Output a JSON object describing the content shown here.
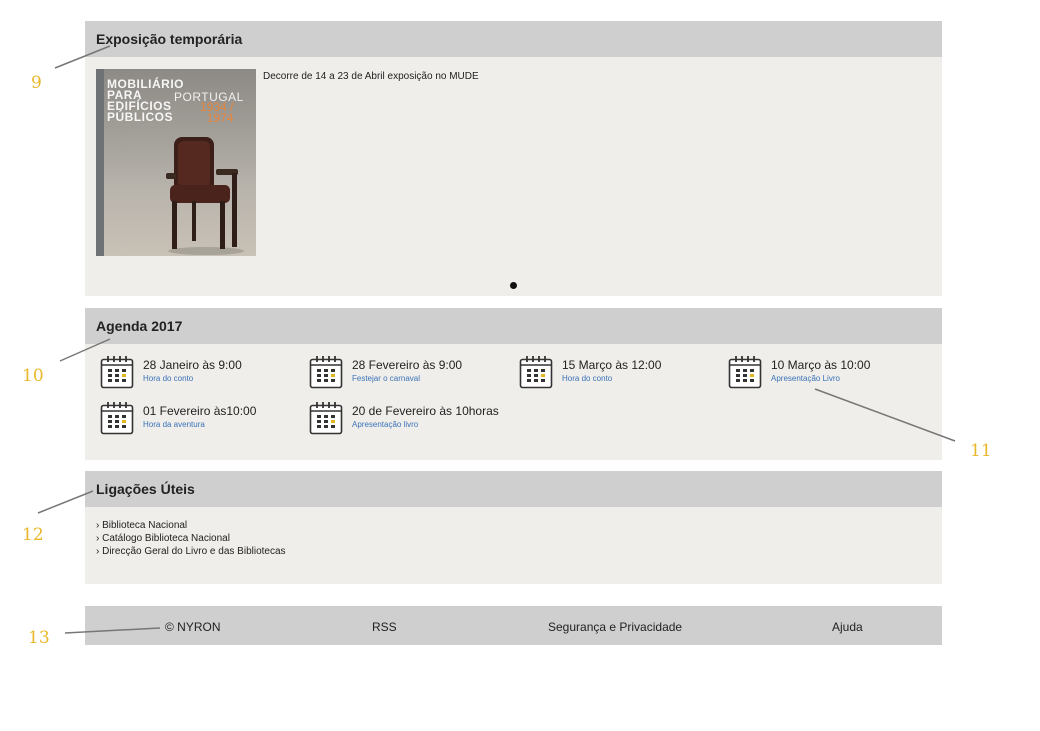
{
  "exhibit": {
    "title": "Exposição temporária",
    "description": "Decorre de 14 a 23 de Abril exposição no MUDE",
    "poster": {
      "title": "MOBILIÁRIO\nPARA\nEDIFÍCIOS\nPÚBLICOS",
      "country": "PORTUGAL",
      "years": "1934 /\n1974"
    }
  },
  "agenda": {
    "title": "Agenda 2017",
    "events": [
      {
        "date": "28 Janeiro às 9:00",
        "link": "Hora do conto"
      },
      {
        "date": "28 Fevereiro às 9:00",
        "link": "Festejar o carnaval"
      },
      {
        "date": "15 Março  às 12:00",
        "link": "Hora do conto"
      },
      {
        "date": "10 Março às 10:00",
        "link": "Apresentação Livro"
      },
      {
        "date": "01 Fevereiro às10:00",
        "link": "Hora da aventura"
      },
      {
        "date": "20 de Fevereiro às 10horas",
        "link": "Apresentação livro"
      }
    ]
  },
  "links": {
    "title": "Ligações Úteis",
    "items": [
      "› Biblioteca Nacional",
      "› Catálogo Biblioteca Nacional",
      "› Direcção Geral do Livro e das Bibliotecas"
    ]
  },
  "footer": {
    "copyright": "© NYRON",
    "rss": "RSS",
    "privacy": "Segurança e Privacidade",
    "help": "Ajuda"
  },
  "callouts": [
    "9",
    "10",
    "11",
    "12",
    "13"
  ],
  "colors": {
    "header_bg": "#cfcfcf",
    "panel_bg": "#efeeea",
    "link": "#3b73b9",
    "callout": "#e9b82a",
    "poster_accent": "#e8863a"
  }
}
